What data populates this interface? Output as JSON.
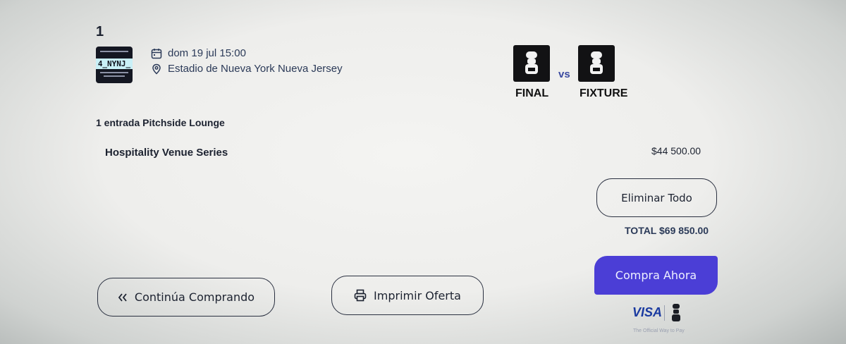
{
  "item": {
    "index": "1",
    "venue_code": "4_NYNJ_",
    "date": "dom 19 jul 15:00",
    "venue": "Estadio de Nueva York Nueva Jersey"
  },
  "match": {
    "home": "FINAL",
    "away": "FIXTURE",
    "vs": "vs"
  },
  "ticket": {
    "title": "1 entrada Pitchside Lounge",
    "series": "Hospitality Venue Series",
    "price": "$44 500.00"
  },
  "cart": {
    "remove_all_label": "Eliminar Todo",
    "total": "TOTAL $69 850.00",
    "buy_label": "Compra Ahora",
    "continue_label": "Continúa Comprando",
    "print_label": "Imprimir Oferta"
  },
  "payment": {
    "brand": "VISA",
    "tagline": "The Official Way to Pay"
  },
  "colors": {
    "accent": "#4b3ed6",
    "text": "#1c2230",
    "link": "#2b3a58"
  }
}
